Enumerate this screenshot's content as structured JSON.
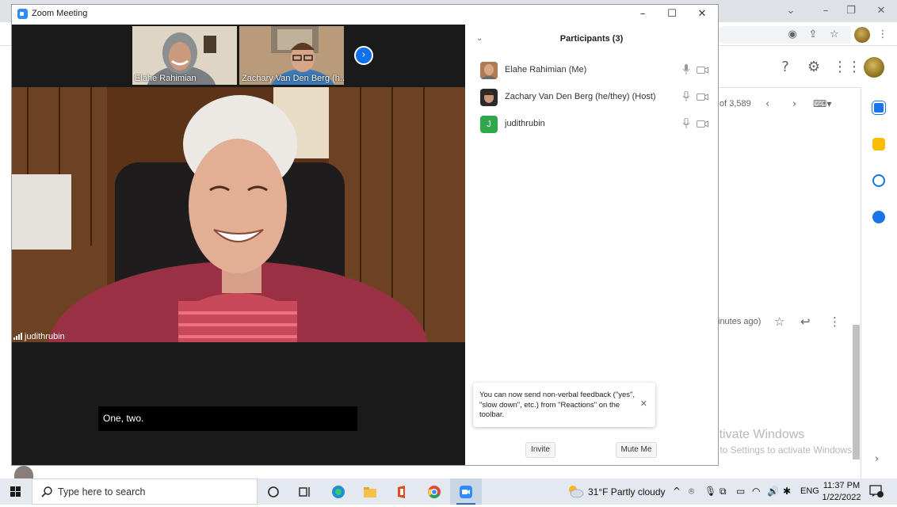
{
  "zoom": {
    "window_title": "Zoom Meeting",
    "gallery": [
      {
        "name": "Elahe Rahimian"
      },
      {
        "name": "Zachary Van Den Berg (h..."
      }
    ],
    "active_speaker": "judithrubin",
    "caption": "One, two.",
    "participants_panel": {
      "title": "Participants (3)",
      "participants": [
        {
          "name": "Elahe Rahimian (Me)",
          "avatar": "photo"
        },
        {
          "name": "Zachary Van Den Berg (he/they) (Host)",
          "avatar": "photo"
        },
        {
          "name": "judithrubin",
          "avatar_letter": "J",
          "avatar_color": "#2ea84a"
        }
      ],
      "tooltip": "You can now send non-verbal feedback (\"yes\", \"slow down\", etc.) from \"Reactions\" on the toolbar.",
      "invite_label": "Invite",
      "mute_label": "Mute Me"
    }
  },
  "gmail": {
    "count_text": "of 3,589",
    "time_text": "inutes ago)"
  },
  "watermark": {
    "line1": "Activate Windows",
    "line2": "Go to Settings to activate Windows."
  },
  "taskbar": {
    "search_placeholder": "Type here to search",
    "weather": "31°F  Partly cloudy",
    "language": "ENG",
    "time": "11:37 PM",
    "date": "1/22/2022",
    "notification_count": "2"
  }
}
